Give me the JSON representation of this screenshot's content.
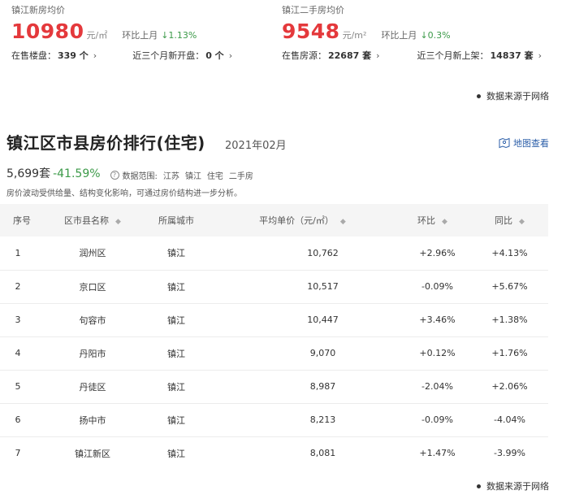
{
  "new_house": {
    "title": "镇江新房均价",
    "price": "10980",
    "unit": "元/㎡",
    "mom_label": "环比上月",
    "mom_value": "↓1.13%",
    "on_sale_label": "在售楼盘：",
    "on_sale_value": "339 个",
    "recent_label": "近三个月新开盘：",
    "recent_value": "0 个"
  },
  "second_hand": {
    "title": "镇江二手房均价",
    "price": "9548",
    "unit": "元/m²",
    "mom_label": "环比上月",
    "mom_value": "↓0.3%",
    "on_sale_label": "在售房源：",
    "on_sale_value": "22687 套",
    "recent_label": "近三个月新上架：",
    "recent_value": "14837 套"
  },
  "source_note": "数据来源于网络",
  "ranking": {
    "title": "镇江区市县房价排行(住宅)",
    "date": "2021年02月",
    "map_link": "地图查看",
    "count": "5,699套",
    "change": "-41.59%",
    "scope_label": "数据范围:",
    "scope_tags": [
      "江苏",
      "镇江",
      "住宅",
      "二手房"
    ],
    "footnote": "房价波动受供给量、结构变化影响，可通过房价结构进一步分析。",
    "columns": [
      "序号",
      "区市县名称",
      "所属城市",
      "平均单价（元/㎡）",
      "环比",
      "同比"
    ],
    "rows": [
      {
        "idx": "1",
        "name": "润州区",
        "city": "镇江",
        "price": "10,762",
        "mom": "+2.96%",
        "yoy": "+4.13%"
      },
      {
        "idx": "2",
        "name": "京口区",
        "city": "镇江",
        "price": "10,517",
        "mom": "-0.09%",
        "yoy": "+5.67%"
      },
      {
        "idx": "3",
        "name": "句容市",
        "city": "镇江",
        "price": "10,447",
        "mom": "+3.46%",
        "yoy": "+1.38%"
      },
      {
        "idx": "4",
        "name": "丹阳市",
        "city": "镇江",
        "price": "9,070",
        "mom": "+0.12%",
        "yoy": "+1.76%"
      },
      {
        "idx": "5",
        "name": "丹徒区",
        "city": "镇江",
        "price": "8,987",
        "mom": "-2.04%",
        "yoy": "+2.06%"
      },
      {
        "idx": "6",
        "name": "扬中市",
        "city": "镇江",
        "price": "8,213",
        "mom": "-0.09%",
        "yoy": "-4.04%"
      },
      {
        "idx": "7",
        "name": "镇江新区",
        "city": "镇江",
        "price": "8,081",
        "mom": "+1.47%",
        "yoy": "-3.99%"
      }
    ]
  },
  "colors": {
    "up": "#e4393c",
    "down": "#3c9a49",
    "link": "#2b5ea8"
  }
}
